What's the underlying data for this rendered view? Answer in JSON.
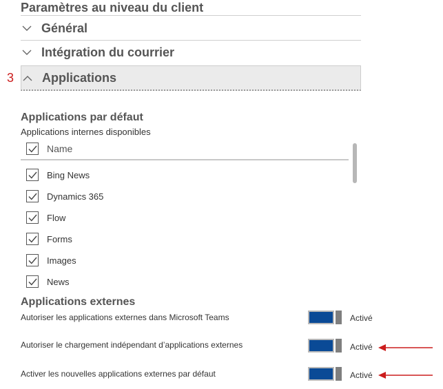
{
  "page_title": "Paramètres au niveau du client",
  "sections": [
    {
      "label": "Général",
      "expanded": false
    },
    {
      "label": "Intégration du courrier",
      "expanded": false
    },
    {
      "label": "Applications",
      "expanded": true
    }
  ],
  "step_marker": "3",
  "default_apps": {
    "heading": "Applications par défaut",
    "subheading": "Applications internes disponibles",
    "column_header": "Name",
    "header_checked": true,
    "items": [
      {
        "name": "Bing News",
        "checked": true
      },
      {
        "name": "Dynamics 365",
        "checked": true
      },
      {
        "name": "Flow",
        "checked": true
      },
      {
        "name": "Forms",
        "checked": true
      },
      {
        "name": "Images",
        "checked": true
      },
      {
        "name": "News",
        "checked": true
      }
    ]
  },
  "external_apps": {
    "heading": "Applications externes",
    "settings": [
      {
        "label": "Autoriser les applications externes dans Microsoft Teams",
        "state": "Activé",
        "on": true,
        "annotated": false
      },
      {
        "label": "Autoriser le chargement indépendant d’applications externes",
        "state": "Activé",
        "on": true,
        "annotated": true
      },
      {
        "label": "Activer les nouvelles applications externes par défaut",
        "state": "Activé",
        "on": true,
        "annotated": true
      }
    ]
  },
  "colors": {
    "accent": "#0a4a96",
    "annotation": "#cc1d1d",
    "heading": "#555555"
  },
  "icons": {
    "collapsed": "chevron-down-icon",
    "expanded": "chevron-up-icon",
    "checkbox": "checkmark-icon",
    "annotation": "arrow-left-icon"
  }
}
